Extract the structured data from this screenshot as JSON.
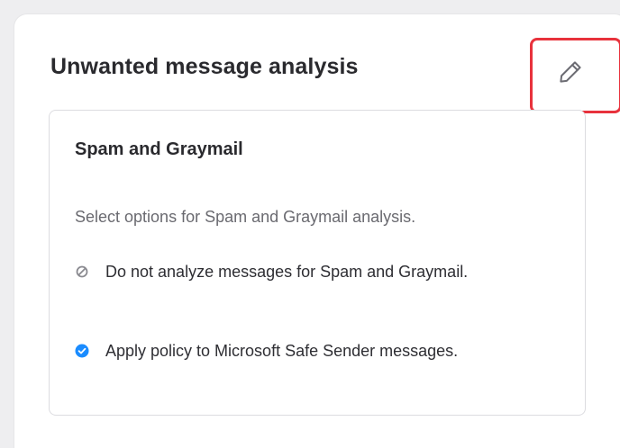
{
  "card": {
    "title": "Unwanted message analysis",
    "edit_icon": "pencil-icon"
  },
  "section": {
    "title": "Spam and Graymail",
    "description": "Select options for Spam and Graymail analysis.",
    "options": [
      {
        "label": "Do not analyze messages for Spam and Graymail.",
        "status_icon": "disabled-icon",
        "enabled": false
      },
      {
        "label": "Apply policy to Microsoft Safe Sender messages.",
        "status_icon": "check-circle-icon",
        "enabled": true
      }
    ]
  },
  "colors": {
    "highlight": "#e8323c",
    "check_blue": "#1a8cff",
    "disabled_gray": "#8a8a90"
  }
}
